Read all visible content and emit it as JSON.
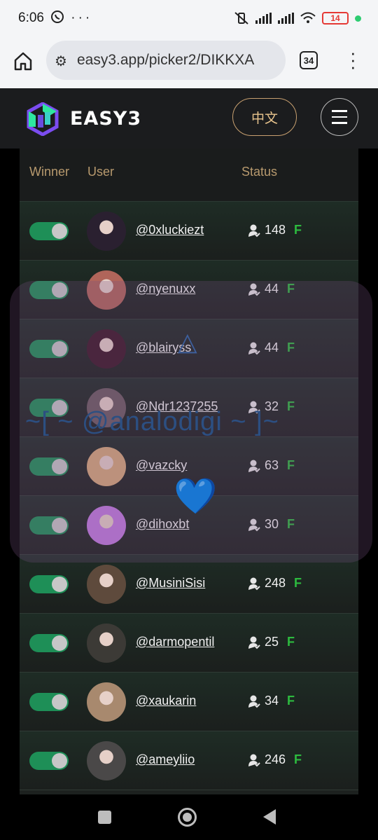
{
  "status_bar": {
    "time": "6:06",
    "left_icons": "whatsapp-icon, more-dots-icon",
    "battery": "14"
  },
  "browser": {
    "url": "easy3.app/picker2/DIKKXA",
    "tab_count": "34"
  },
  "header": {
    "brand": "EASY3",
    "lang_button": "中文"
  },
  "table": {
    "columns": [
      "Winner",
      "User",
      "Status"
    ],
    "rows": [
      {
        "username": "@0xluckiezt",
        "count": "148",
        "badge": "F",
        "avatar_color": "#2a2030"
      },
      {
        "username": "@nyenuxx",
        "count": "44",
        "badge": "F",
        "avatar_color": "#b0655a"
      },
      {
        "username": "@blairyss",
        "count": "44",
        "badge": "F",
        "avatar_color": "#3a1626"
      },
      {
        "username": "@Ndr1237255",
        "count": "32",
        "badge": "F",
        "avatar_color": "#6b5b60"
      },
      {
        "username": "@vazcky",
        "count": "63",
        "badge": "F",
        "avatar_color": "#d6a97a"
      },
      {
        "username": "@dihoxbt",
        "count": "30",
        "badge": "F",
        "avatar_color": "#c07ae0"
      },
      {
        "username": "@MusiniSisi",
        "count": "248",
        "badge": "F",
        "avatar_color": "#5e4a3c"
      },
      {
        "username": "@darmopentil",
        "count": "25",
        "badge": "F",
        "avatar_color": "#3c3a36"
      },
      {
        "username": "@xaukarin",
        "count": "34",
        "badge": "F",
        "avatar_color": "#a8896e"
      },
      {
        "username": "@ameyliio",
        "count": "246",
        "badge": "F",
        "avatar_color": "#4a4848"
      }
    ]
  },
  "overlay": {
    "symbol": "△",
    "handle": "~[ ~ @analodigi ~ ]~",
    "heart": "💙"
  },
  "colors": {
    "accent_gold": "#c8a070",
    "toggle_green": "#1e8f57",
    "badge_green": "#2dbb3f"
  }
}
